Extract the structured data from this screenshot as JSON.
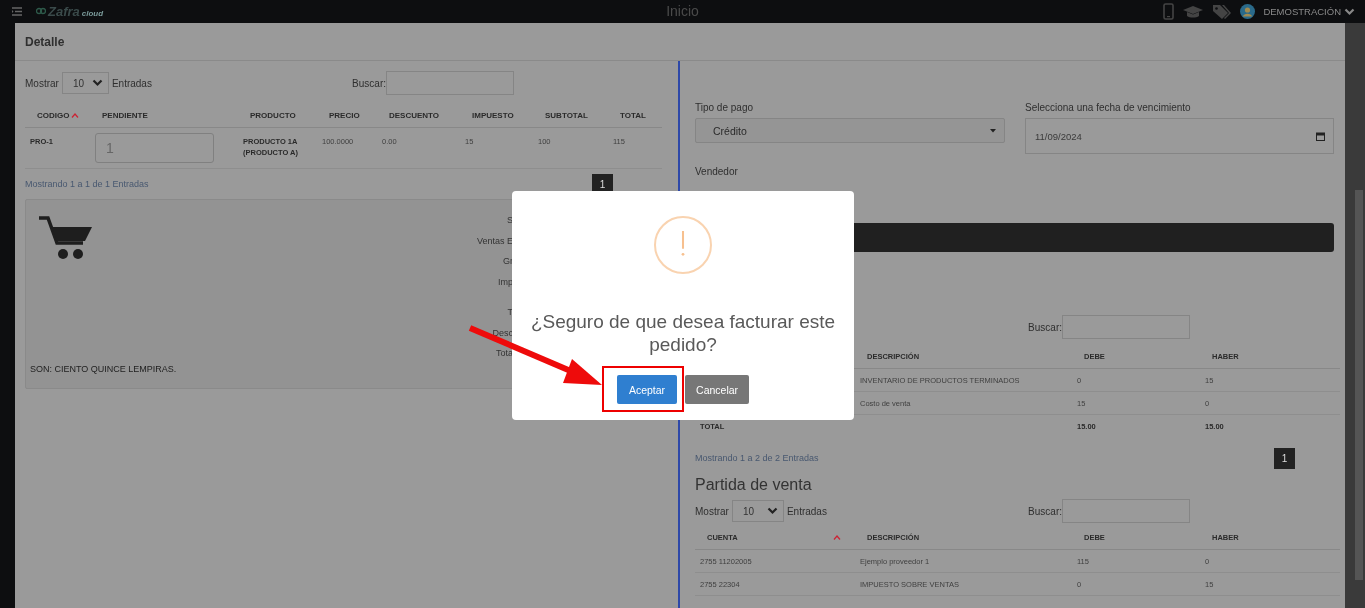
{
  "topbar": {
    "logo": "Zafra",
    "logo_sub": "cloud",
    "title": "Inicio",
    "user": "DEMOSTRACIÓN"
  },
  "modal": {
    "title": "Detalle"
  },
  "products": {
    "show_label": "Mostrar",
    "page_size": "10",
    "entries_label": "Entradas",
    "search_label": "Buscar:",
    "columns": [
      {
        "label": "CODIGO",
        "sorted": true
      },
      {
        "label": "PENDIENTE",
        "sorted": false
      },
      {
        "label": "PRODUCTO",
        "sorted": false
      },
      {
        "label": "PRECIO",
        "sorted": false
      },
      {
        "label": "DESCUENTO",
        "sorted": false
      },
      {
        "label": "IMPUESTO",
        "sorted": false
      },
      {
        "label": "SUBTOTAL",
        "sorted": false
      },
      {
        "label": "TOTAL",
        "sorted": false
      }
    ],
    "rows": [
      {
        "codigo": "PRO-1",
        "pendiente": "1",
        "producto": "PRODUCTO 1A (PRODUCTO A)",
        "precio": "100.0000",
        "descuento": "0.00",
        "impuesto": "15",
        "subtotal": "100",
        "total": "115"
      }
    ],
    "info": "Mostrando 1 a 1 de 1 Entradas",
    "pages": [
      {
        "label": "1",
        "selected": true
      }
    ]
  },
  "summary": {
    "groups": [
      [
        "S",
        "Ventas E",
        "Gr",
        "Imp"
      ],
      [
        "T",
        "Desc",
        "Tota"
      ]
    ],
    "amount_words": "SON: CIENTO QUINCE LEMPIRAS."
  },
  "payment": {
    "type_label": "Tipo de pago",
    "type_value": "Crédito",
    "date_label": "Selecciona una fecha de vencimiento",
    "date_value": "11/09/2024",
    "seller_label": "Vendedor"
  },
  "cost_entry": {
    "search_label": "Buscar:",
    "columns": [
      {
        "label": "DESCRIPCIÓN",
        "sorted": false
      },
      {
        "label": "DEBE",
        "sorted": false
      },
      {
        "label": "HABER",
        "sorted": false
      }
    ],
    "rows": [
      [
        "INVENTARIO DE PRODUCTOS TERMINADOS",
        "0",
        "15"
      ],
      [
        "Costo de venta",
        "15",
        "0"
      ]
    ],
    "total": {
      "label": "TOTAL",
      "debe": "15.00",
      "haber": "15.00"
    },
    "info": "Mostrando 1 a 2 de 2 Entradas",
    "pages": [
      {
        "label": "1",
        "selected": true
      }
    ]
  },
  "sales_entry": {
    "title": "Partida de venta",
    "show_label": "Mostrar",
    "page_size": "10",
    "entries_label": "Entradas",
    "search_label": "Buscar:",
    "columns": [
      {
        "label": "CUENTA",
        "sorted": true
      },
      {
        "label": "DESCRIPCIÓN",
        "sorted": false
      },
      {
        "label": "DEBE",
        "sorted": false
      },
      {
        "label": "HABER",
        "sorted": false
      }
    ],
    "rows": [
      [
        "2755 11202005",
        "Ejemplo proveedor 1",
        "115",
        "0"
      ],
      [
        "2755 22304",
        "IMPUESTO SOBRE VENTAS",
        "0",
        "15"
      ]
    ]
  },
  "dialog": {
    "title": "¿Seguro de que desea facturar este pedido?",
    "confirm": "Aceptar",
    "cancel": "Cancelar"
  }
}
